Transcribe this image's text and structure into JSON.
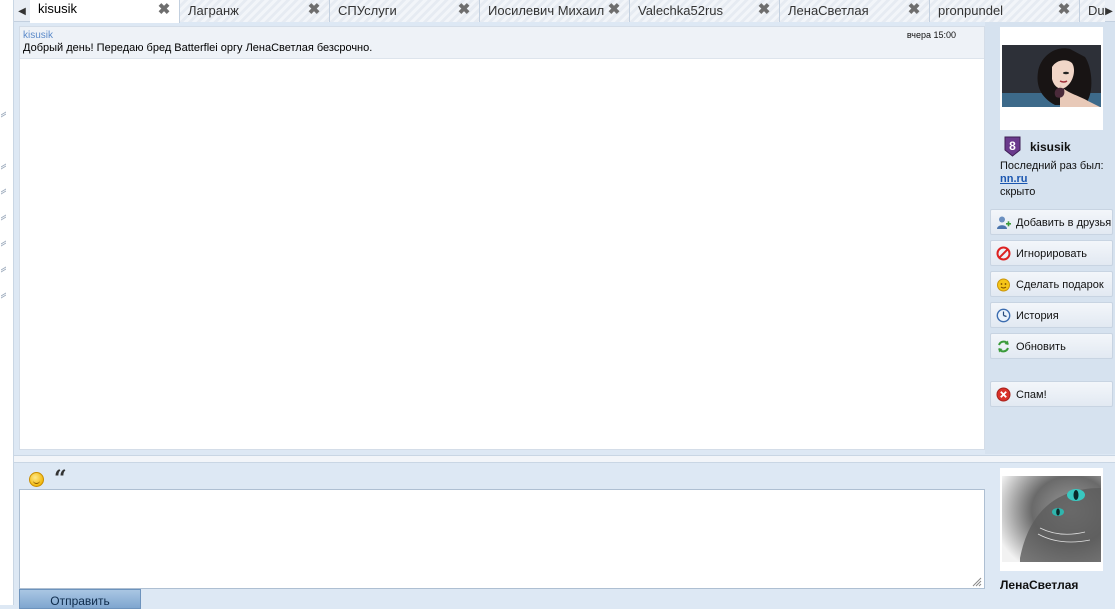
{
  "tabs": [
    {
      "label": "kisusik",
      "active": true
    },
    {
      "label": "Лагранж",
      "active": false
    },
    {
      "label": "СПУслуги",
      "active": false
    },
    {
      "label": "Иосилевич Михаил",
      "active": false
    },
    {
      "label": "Valechka52rus",
      "active": false
    },
    {
      "label": "ЛенаСветлая",
      "active": false
    },
    {
      "label": "pronpundel",
      "active": false
    },
    {
      "label": "Du",
      "active": false
    }
  ],
  "messages": [
    {
      "author": "kisusik",
      "time": "вчера 15:00",
      "text": "Добрый день! Передаю бред Batterflei оргу ЛенаСветлая безсрочно."
    }
  ],
  "profile": {
    "name": "kisusik",
    "level": "8",
    "last_seen_label": "Последний раз был:",
    "last_seen_site": "nn.ru",
    "last_seen_status": "скрыто"
  },
  "actions": {
    "add_friend": "Добавить в друзья",
    "ignore": "Игнорировать",
    "gift": "Сделать подарок",
    "history": "История",
    "refresh": "Обновить",
    "spam": "Спам!"
  },
  "composer": {
    "value": "",
    "send_label": "Отправить"
  },
  "me": {
    "name": "ЛенаСветлая"
  },
  "colors": {
    "link": "#1a56b0",
    "author": "#5b8ac9",
    "background": "#dde8f4",
    "send_button": "#7fa6cf"
  },
  "icons": {
    "smile": "smile-icon",
    "quote": "quote-icon",
    "tab_close": "close-icon"
  }
}
